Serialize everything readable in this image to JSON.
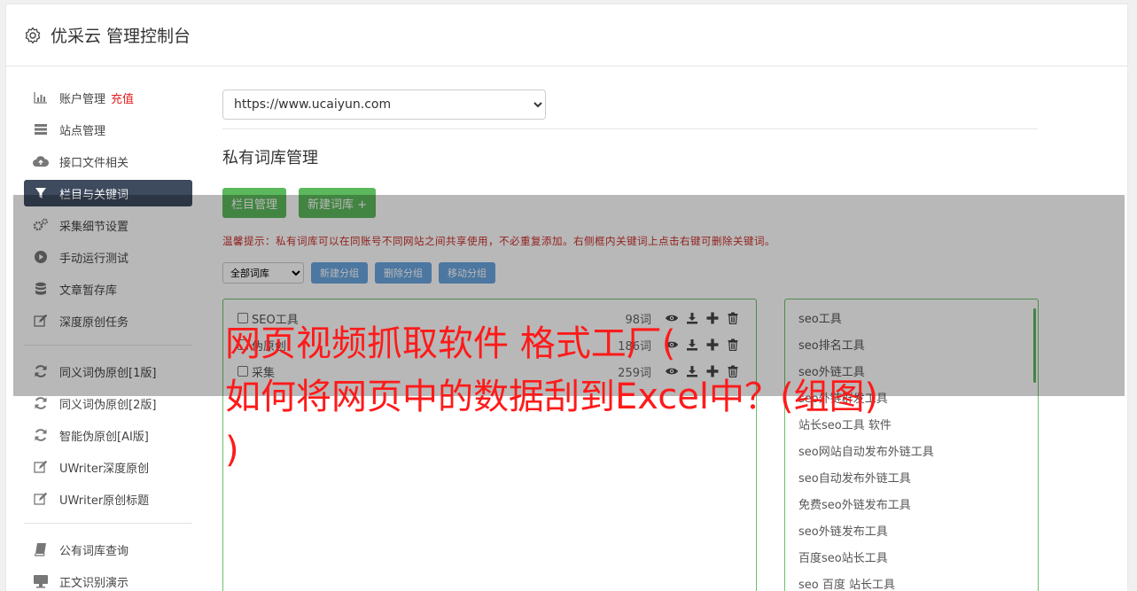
{
  "header": {
    "title": "优采云 管理控制台"
  },
  "sidebar": {
    "group1": [
      {
        "label": "账户管理",
        "badge": "充值",
        "icon": "bar-chart-icon"
      },
      {
        "label": "站点管理",
        "icon": "server-icon"
      },
      {
        "label": "接口文件相关",
        "icon": "cloud-upload-icon"
      },
      {
        "label": "栏目与关键词",
        "icon": "filter-icon",
        "active": true
      },
      {
        "label": "采集细节设置",
        "icon": "cogs-icon"
      },
      {
        "label": "手动运行测试",
        "icon": "play-circle-icon"
      },
      {
        "label": "文章暂存库",
        "icon": "database-icon"
      },
      {
        "label": "深度原创任务",
        "icon": "edit-icon"
      }
    ],
    "group2": [
      {
        "label": "同义词伪原创[1版]",
        "icon": "refresh-icon"
      },
      {
        "label": "同义词伪原创[2版]",
        "icon": "refresh-icon"
      },
      {
        "label": "智能伪原创[AI版]",
        "icon": "refresh-icon"
      },
      {
        "label": "UWriter深度原创",
        "icon": "edit-icon"
      },
      {
        "label": "UWriter原创标题",
        "icon": "edit-icon"
      }
    ],
    "group3": [
      {
        "label": "公有词库查询",
        "icon": "book-icon"
      },
      {
        "label": "正文识别演示",
        "icon": "monitor-icon"
      }
    ]
  },
  "main": {
    "site_select": "https://www.ucaiyun.com",
    "section_title": "私有词库管理",
    "buttons": {
      "column_manage": "栏目管理",
      "new_library": "新建词库 +"
    },
    "tip": "温馨提示：私有词库可以在同账号不同网站之间共享使用，不必重复添加。右侧框内关键词上点击右键可删除关键词。",
    "group_select": "全部词库",
    "group_buttons": {
      "new_group": "新建分组",
      "delete_group": "删除分组",
      "move_group": "移动分组"
    },
    "libraries": [
      {
        "name": "SEO工具",
        "count": "98词"
      },
      {
        "name": "伪原创",
        "count": "186词"
      },
      {
        "name": "采集",
        "count": "259词"
      }
    ],
    "keywords": [
      "seo工具",
      "seo排名工具",
      "seo外链工具",
      "seo外链群发工具",
      "站长seo工具 软件",
      "seo网站自动发布外链工具",
      "seo自动发布外链工具",
      "免费seo外链发布工具",
      "seo外链发布工具",
      "百度seo站长工具",
      "seo 百度 站长工具"
    ]
  },
  "overlay_caption": {
    "line1": "网页视频抓取软件 格式工厂(",
    "line2": "如何将网页中的数据刮到Excel中？(组图)",
    "line3": ")"
  },
  "colors": {
    "accent_green": "#5cb85c",
    "active_nav": "#3e4a5e",
    "tip_red": "#c9302c",
    "caption_red": "#ff1a1a"
  }
}
